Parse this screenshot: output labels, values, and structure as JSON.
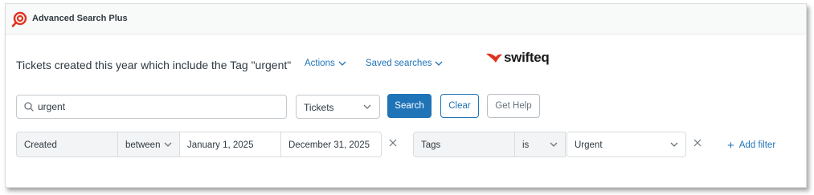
{
  "app": {
    "title": "Advanced Search Plus",
    "logo_icon": "target-search-icon",
    "accent_color": "#e0321d"
  },
  "header": {
    "page_title": "Tickets created this year which include the Tag \"urgent\"",
    "actions_label": "Actions",
    "saved_searches_label": "Saved searches"
  },
  "brand": {
    "name": "swifteq",
    "color": "#e0321d"
  },
  "search": {
    "value": "urgent",
    "icon": "search-icon",
    "object_type": "Tickets",
    "search_label": "Search",
    "clear_label": "Clear",
    "help_label": "Get Help",
    "primary_color": "#1f73b7"
  },
  "filters": [
    {
      "field": "Created",
      "operator": "between",
      "value_from": "January 1, 2025",
      "value_to": "December 31, 2025"
    },
    {
      "field": "Tags",
      "operator": "is",
      "value": "Urgent"
    }
  ],
  "add_filter_label": "Add filter"
}
